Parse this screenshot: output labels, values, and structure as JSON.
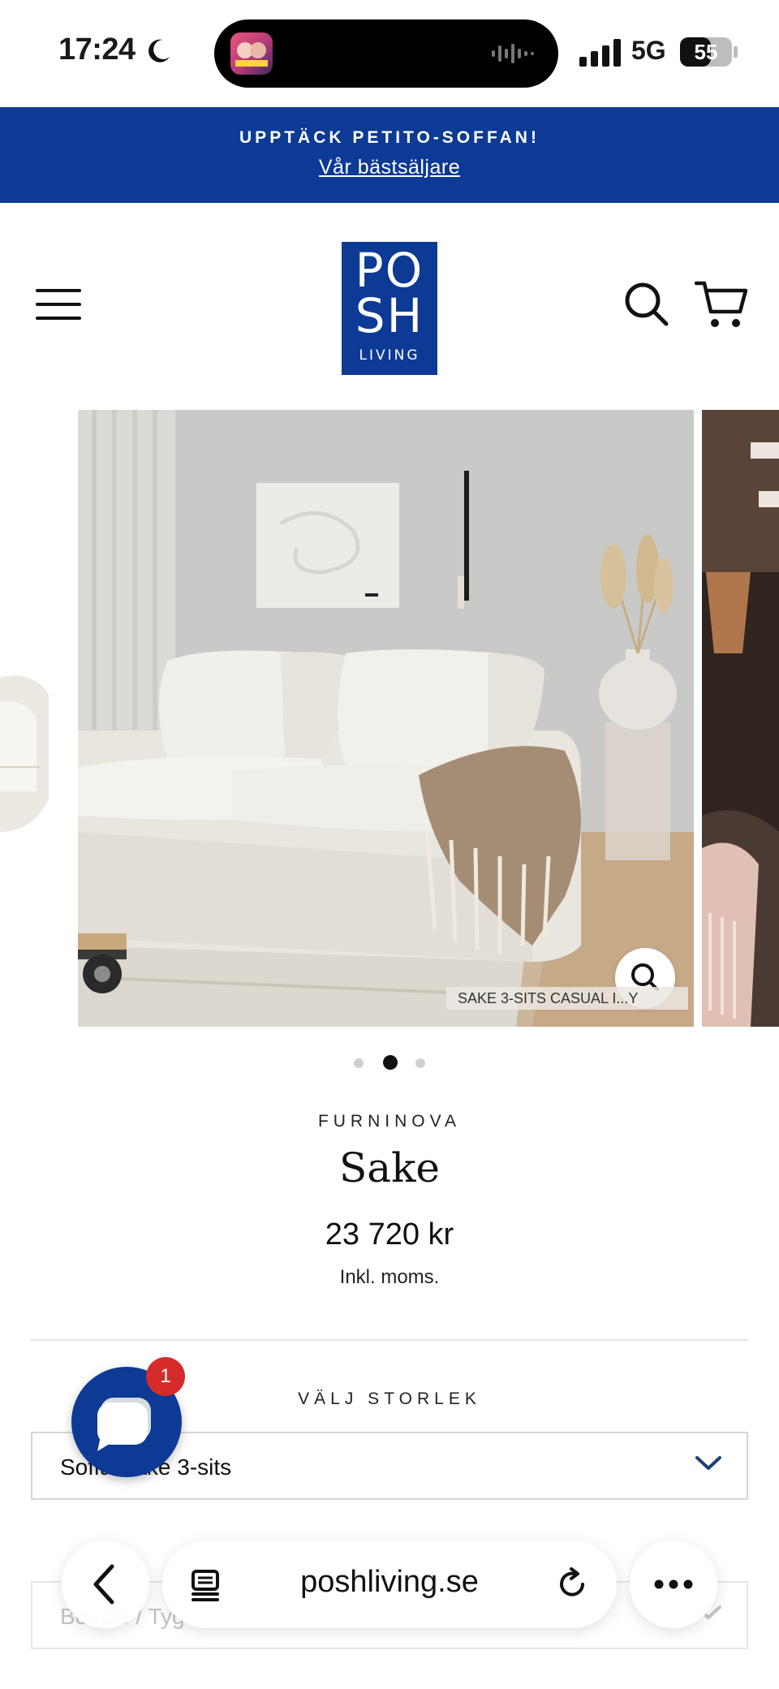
{
  "status_bar": {
    "time": "17:24",
    "network": "5G",
    "battery": "55"
  },
  "announcement": {
    "title": "UPPTÄCK PETITO-SOFFAN!",
    "link": "Vår bästsäljare"
  },
  "header": {
    "logo_line1": "PO",
    "logo_line2": "SH",
    "logo_line3": "LIVING"
  },
  "gallery": {
    "caption": "SAKE 3-SITS CASUAL I...Y",
    "slide_count": 3,
    "active_slide": 2
  },
  "product": {
    "vendor": "FURNINOVA",
    "title": "Sake",
    "price": "23 720 kr",
    "tax_note": "Inkl. moms."
  },
  "options": {
    "size_label": "VÄLJ STORLEK",
    "size_value": "Soffa Sake 3-sits",
    "second_value": "Bouclé / Tyg"
  },
  "chat": {
    "badge": "1"
  },
  "browser": {
    "url": "poshliving.se"
  },
  "colors": {
    "brand_blue": "#0c3a95",
    "badge_red": "#d62b2b"
  },
  "icons": [
    "moon-icon",
    "signal-icon",
    "battery-icon",
    "menu-icon",
    "search-icon",
    "cart-icon",
    "zoom-icon",
    "chevron-down-icon",
    "chat-icon",
    "back-icon",
    "tabs-icon",
    "reload-icon",
    "more-icon"
  ]
}
